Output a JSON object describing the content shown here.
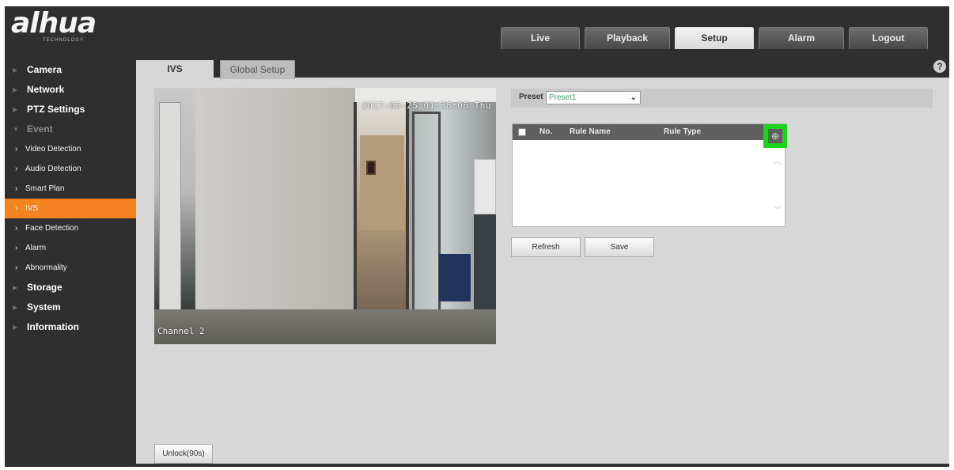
{
  "brand": {
    "name": "alhua",
    "tagline": "TECHNOLOGY"
  },
  "topnav": [
    {
      "label": "Live"
    },
    {
      "label": "Playback"
    },
    {
      "label": "Setup"
    },
    {
      "label": "Alarm"
    },
    {
      "label": "Logout"
    }
  ],
  "active_topnav": "Setup",
  "sidebar": {
    "camera": "Camera",
    "network": "Network",
    "ptz": "PTZ Settings",
    "event": "Event",
    "event_subs": {
      "video_detection": "Video Detection",
      "audio_detection": "Audio Detection",
      "smart_plan": "Smart Plan",
      "ivs": "IVS",
      "face_detection": "Face Detection",
      "alarm": "Alarm",
      "abnormality": "Abnormality"
    },
    "storage": "Storage",
    "system": "System",
    "information": "Information"
  },
  "tabs": {
    "ivs": "IVS",
    "global": "Global Setup"
  },
  "help_glyph": "?",
  "video": {
    "timestamp": "2017-05-25 01:38:06 Thu",
    "channel": "Channel 2"
  },
  "preset": {
    "label": "Preset",
    "value": "Preset1"
  },
  "rule_table": {
    "headers": {
      "no": "No.",
      "name": "Rule Name",
      "type": "Rule Type"
    },
    "add_glyph": "⊕",
    "rows": []
  },
  "buttons": {
    "refresh": "Refresh",
    "save": "Save",
    "unlock": "Unlock(90s)"
  },
  "colors": {
    "active_item": "#f58220",
    "add_highlight": "#1bd31b",
    "preset_text": "#2bb35a"
  }
}
